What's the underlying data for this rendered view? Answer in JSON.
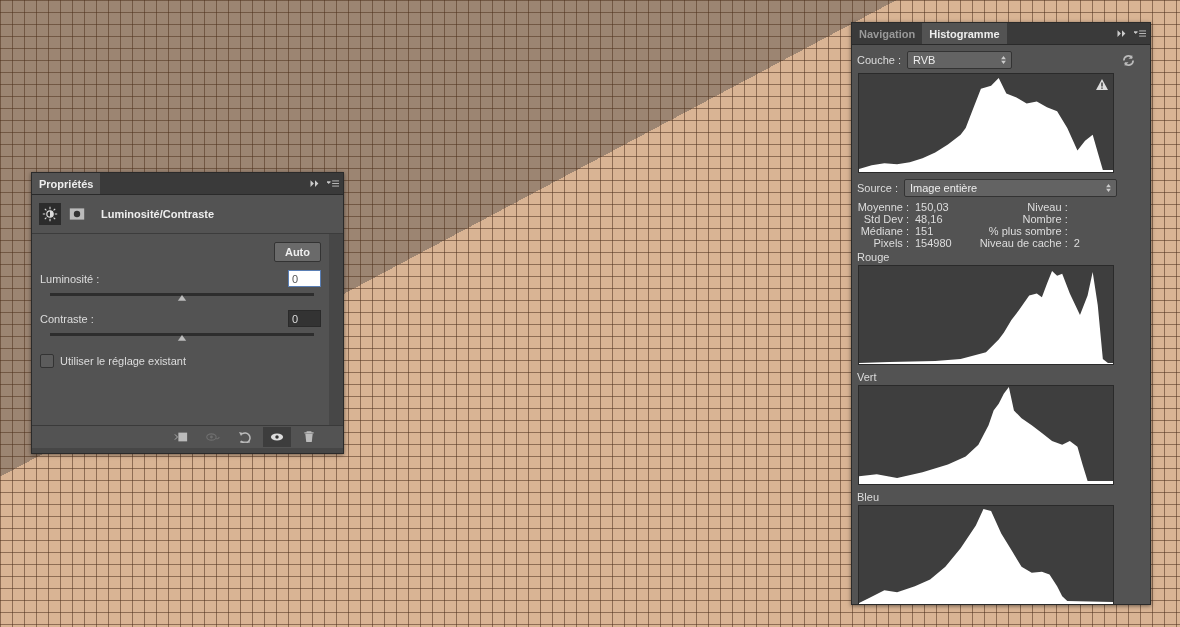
{
  "properties_panel": {
    "tabs": [
      {
        "label": "Propriétés",
        "selected": true
      }
    ],
    "mode_icons": [
      {
        "kind": "sun",
        "selected": true
      },
      {
        "kind": "mask",
        "selected": false
      }
    ],
    "adjustment_title": "Luminosité/Contraste",
    "auto_button": "Auto",
    "sliders": [
      {
        "label": "Luminosité :",
        "value": "0",
        "focused": true,
        "level": 0.5
      },
      {
        "label": "Contraste :",
        "value": "0",
        "focused": false,
        "level": 0.5
      }
    ],
    "checkbox": {
      "label": "Utiliser le réglage existant",
      "checked": false
    },
    "footer_tools": [
      {
        "kind": "clip",
        "disabled": false,
        "selected": false
      },
      {
        "kind": "view-previous",
        "disabled": true,
        "selected": false
      },
      {
        "kind": "reset",
        "disabled": false,
        "selected": false
      },
      {
        "kind": "eye",
        "disabled": false,
        "selected": true
      },
      {
        "kind": "trash",
        "disabled": false,
        "selected": false
      }
    ]
  },
  "histogram_panel": {
    "tabs": [
      {
        "label": "Navigation",
        "selected": false
      },
      {
        "label": "Histogramme",
        "selected": true
      }
    ],
    "channel_label": "Couche :",
    "channel_value": "RVB",
    "source_label": "Source :",
    "source_value": "Image entière",
    "stats_left": [
      {
        "label": "Moyenne :",
        "value": "150,03"
      },
      {
        "label": "Std Dev :",
        "value": "48,16"
      },
      {
        "label": "Médiane :",
        "value": "151"
      },
      {
        "label": "Pixels :",
        "value": "154980"
      }
    ],
    "stats_right": [
      {
        "label": "Niveau :"
      },
      {
        "label": "Nombre :"
      },
      {
        "label": "% plus sombre :"
      },
      {
        "label": "Niveau de cache :",
        "value": "2"
      }
    ],
    "channels": [
      {
        "name": "Rouge"
      },
      {
        "name": "Vert"
      },
      {
        "name": "Bleu"
      }
    ]
  }
}
